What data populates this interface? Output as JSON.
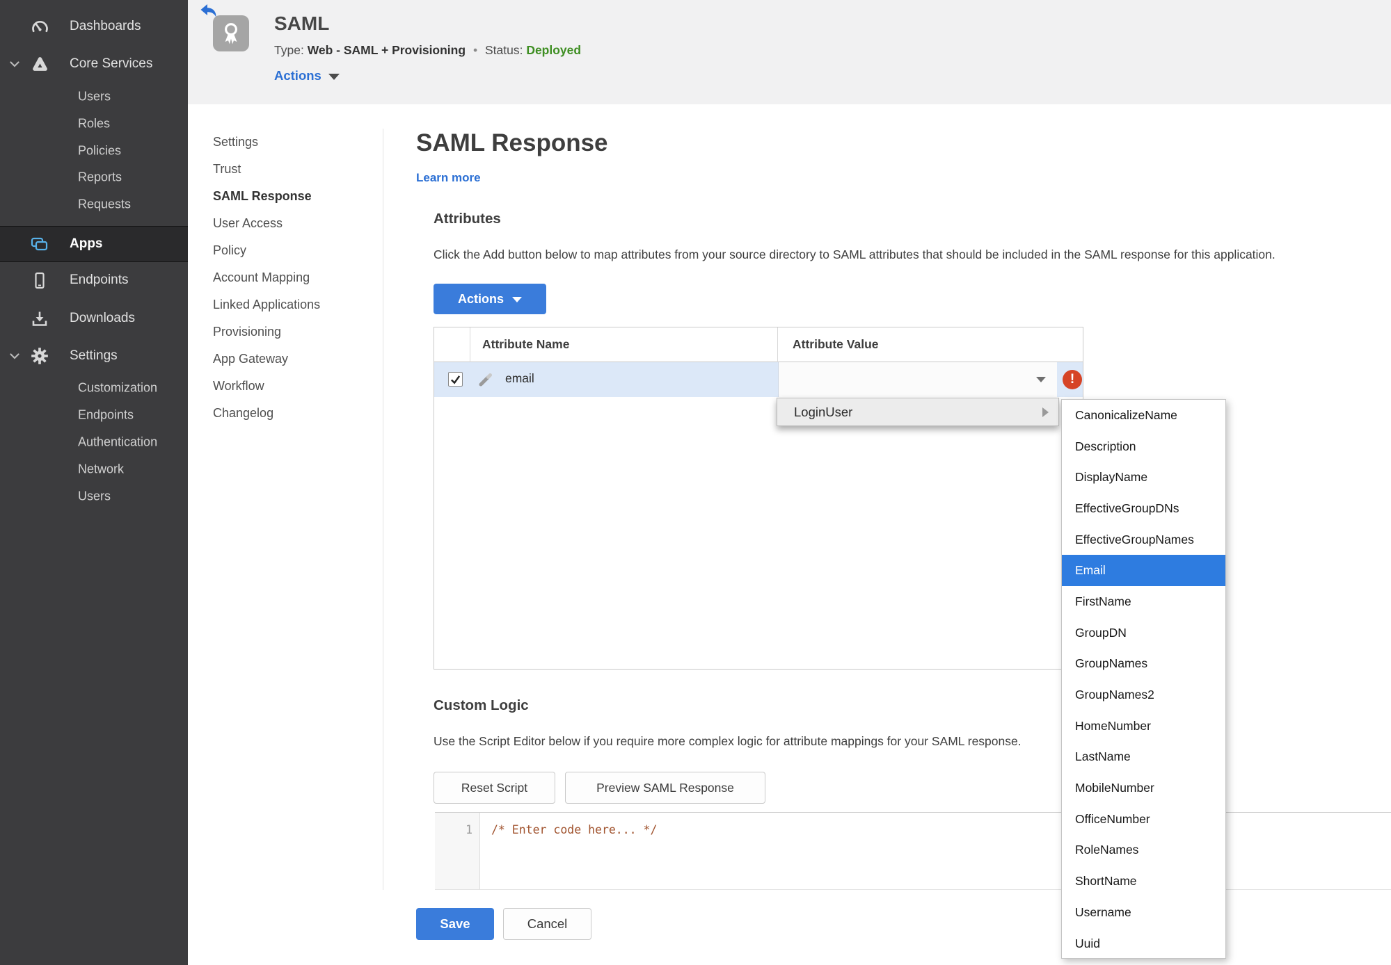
{
  "colors": {
    "accent_blue": "#3a7cdb",
    "selection_blue": "#2e7ce0",
    "row_highlight": "#dce8f8",
    "status_green": "#3e8e22",
    "error_red": "#d64426",
    "sidebar_bg": "#3c3c3e"
  },
  "sidebar": {
    "items": [
      {
        "label": "Dashboards",
        "icon": "gauge-icon"
      },
      {
        "label": "Core Services",
        "icon": "core-services-icon",
        "expanded": true,
        "children": [
          {
            "label": "Users"
          },
          {
            "label": "Roles"
          },
          {
            "label": "Policies"
          },
          {
            "label": "Reports"
          },
          {
            "label": "Requests"
          }
        ]
      },
      {
        "label": "Apps",
        "icon": "apps-icon",
        "active": true
      },
      {
        "label": "Endpoints",
        "icon": "endpoint-icon"
      },
      {
        "label": "Downloads",
        "icon": "download-icon"
      },
      {
        "label": "Settings",
        "icon": "gear-icon",
        "expanded": true,
        "children": [
          {
            "label": "Customization"
          },
          {
            "label": "Endpoints"
          },
          {
            "label": "Authentication"
          },
          {
            "label": "Network"
          },
          {
            "label": "Users"
          }
        ]
      }
    ]
  },
  "header": {
    "app_title": "SAML",
    "type_label": "Type:",
    "type_value": "Web - SAML + Provisioning",
    "dot": "•",
    "status_label": "Status:",
    "status_value": "Deployed",
    "actions_label": "Actions"
  },
  "subnav": {
    "items": [
      {
        "label": "Settings"
      },
      {
        "label": "Trust"
      },
      {
        "label": "SAML Response",
        "active": true
      },
      {
        "label": "User Access"
      },
      {
        "label": "Policy"
      },
      {
        "label": "Account Mapping"
      },
      {
        "label": "Linked Applications"
      },
      {
        "label": "Provisioning"
      },
      {
        "label": "App Gateway"
      },
      {
        "label": "Workflow"
      },
      {
        "label": "Changelog"
      }
    ]
  },
  "main": {
    "page_title": "SAML Response",
    "learn_more": "Learn more",
    "attributes": {
      "heading": "Attributes",
      "description": "Click the Add button below to map attributes from your source directory to SAML attributes that should be included in the SAML response for this application.",
      "actions_button": "Actions",
      "table": {
        "columns": [
          "Attribute Name",
          "Attribute Value"
        ],
        "rows": [
          {
            "name": "email",
            "value": "",
            "checked": true,
            "error": "!"
          }
        ]
      }
    },
    "value_menu": {
      "root_item": "LoginUser",
      "selected": "Email",
      "submenu": [
        "CanonicalizeName",
        "Description",
        "DisplayName",
        "EffectiveGroupDNs",
        "EffectiveGroupNames",
        "Email",
        "FirstName",
        "GroupDN",
        "GroupNames",
        "GroupNames2",
        "HomeNumber",
        "LastName",
        "MobileNumber",
        "OfficeNumber",
        "RoleNames",
        "ShortName",
        "Username",
        "Uuid"
      ]
    },
    "custom_logic": {
      "heading": "Custom Logic",
      "description": "Use the Script Editor below if you require more complex logic for attribute mappings for your SAML response.",
      "reset_button": "Reset Script",
      "preview_button": "Preview SAML Response",
      "editor": {
        "line_number": "1",
        "code": "/* Enter code here... */"
      }
    },
    "footer": {
      "save": "Save",
      "cancel": "Cancel"
    }
  }
}
